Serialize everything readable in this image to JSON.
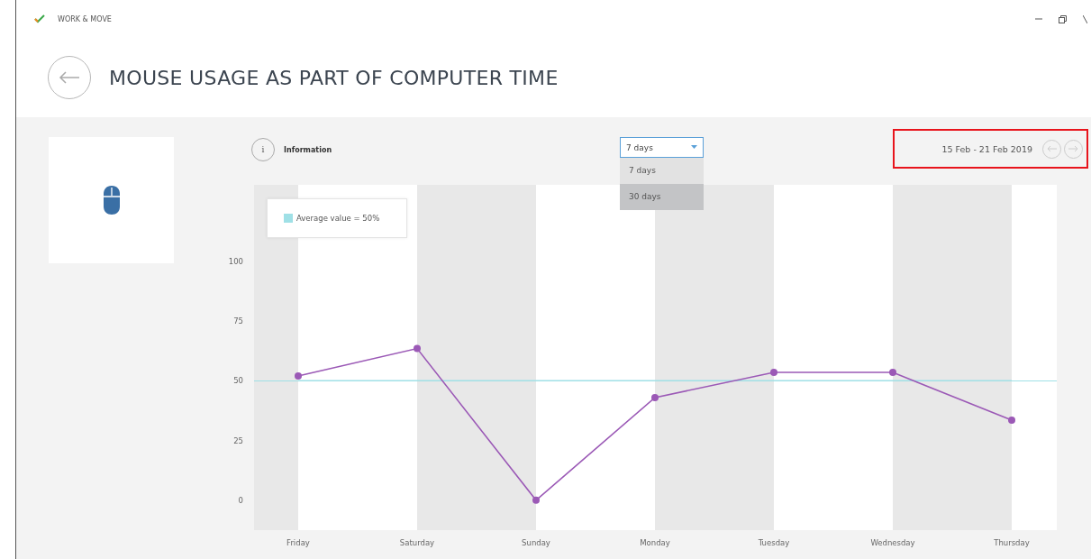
{
  "window": {
    "title": "WORK & MOVE"
  },
  "page": {
    "title": "MOUSE USAGE AS PART OF COMPUTER TIME"
  },
  "toolbar": {
    "info_icon": "i",
    "info_label": "Information",
    "period": {
      "value": "7 days",
      "expanded": true,
      "options": [
        {
          "label": "7 days",
          "hovered": false
        },
        {
          "label": "30 days",
          "hovered": true
        }
      ]
    },
    "date_range": "15 Feb - 21 Feb 2019",
    "highlighted": true
  },
  "chart": {
    "legend_suffix": "= 50%",
    "chart_data": {
      "type": "line",
      "categories": [
        "Friday",
        "Saturday",
        "Sunday",
        "Monday",
        "Tuesday",
        "Wednesday",
        "Thursday"
      ],
      "series": [
        {
          "color": "#9b59b6",
          "marker": "circle",
          "values": [
            52,
            63.5,
            0,
            43,
            53.5,
            53.5,
            33.5
          ]
        },
        {
          "name": "Average value",
          "color": "#9fe0e6",
          "values": [
            50,
            50,
            50,
            50,
            50,
            50,
            50
          ]
        }
      ],
      "ylim": [
        -12.5,
        132
      ],
      "yticks": [
        0,
        25,
        50,
        75,
        100
      ]
    }
  }
}
